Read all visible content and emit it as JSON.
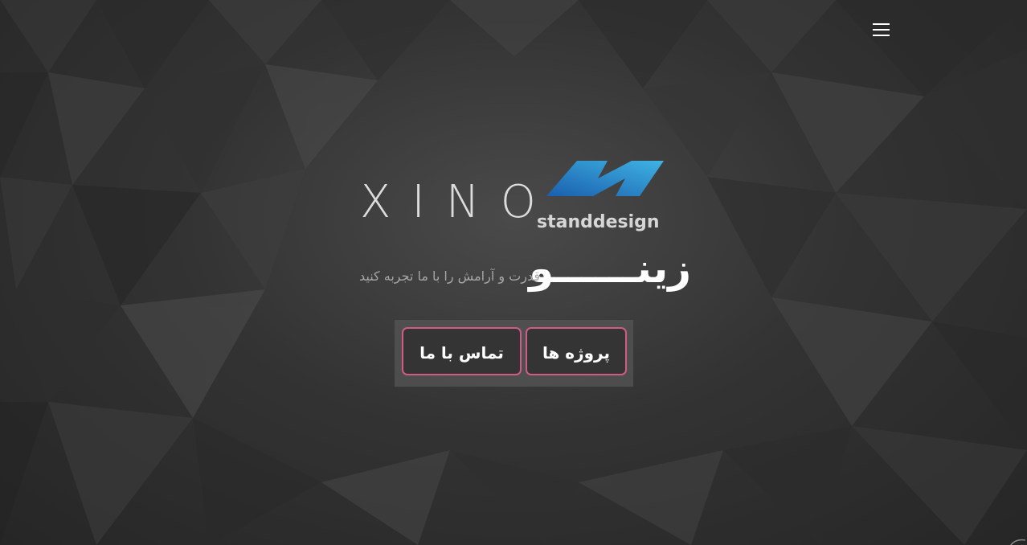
{
  "hero": {
    "logo_word": "XINO",
    "logo_sub": "standdesign",
    "brand_title": "زینــــــو",
    "tagline": "قدرت و آرامش را با ما تجربه کنید"
  },
  "buttons": {
    "projects_label": "پروژه ها",
    "contact_label": "تماس با ما"
  },
  "colors": {
    "accent_border": "#d05c85",
    "logo_gradient_start": "#1e73c8",
    "logo_gradient_end": "#3ab0e0"
  },
  "icons": {
    "menu": "hamburger-menu-icon",
    "logo_mark": "xino-wave-logo-mark"
  }
}
